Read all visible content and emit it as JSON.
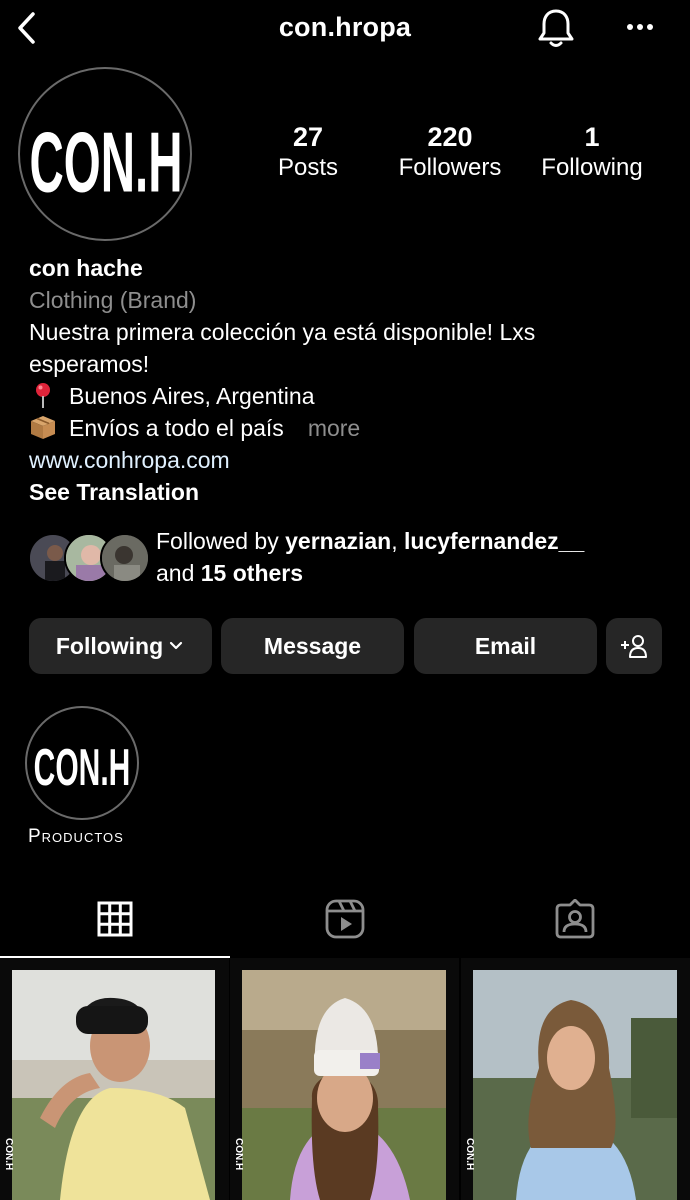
{
  "header": {
    "username": "con.hropa",
    "back_icon": "chevron-left-icon",
    "notification_icon": "bell-icon",
    "more_icon": "more-horizontal-icon"
  },
  "profile": {
    "avatar_text": "CON.H",
    "stats": [
      {
        "value": "27",
        "label": "Posts"
      },
      {
        "value": "220",
        "label": "Followers"
      },
      {
        "value": "1",
        "label": "Following"
      }
    ],
    "name": "con hache",
    "category": "Clothing (Brand)",
    "bio_line1": "Nuestra primera colección ya está disponible! Lxs",
    "bio_line2": "esperamos!",
    "location": "Buenos Aires, Argentina",
    "shipping": "Envíos a todo el país",
    "more_label": "more",
    "website": "www.conhropa.com",
    "see_translation": "See Translation"
  },
  "followed_by": {
    "prefix": "Followed by",
    "user1": "yernazian",
    "separator": ",",
    "user2": "lucyfernandez__",
    "and_label": "and",
    "others": "15 others"
  },
  "actions": {
    "following": "Following",
    "message": "Message",
    "email": "Email",
    "add_user_icon": "add-person-icon"
  },
  "highlight": {
    "label": "Productos",
    "cover_text": "CON.H"
  },
  "tabs": [
    {
      "name": "grid-icon",
      "active": true
    },
    {
      "name": "reels-icon",
      "active": false
    },
    {
      "name": "tagged-icon",
      "active": false
    }
  ],
  "posts": [
    {
      "film_label": "CON.H",
      "description": "man in black beanie and yellow shirt"
    },
    {
      "film_label": "CON.H",
      "description": "woman in white beanie"
    },
    {
      "film_label": "CON.H",
      "description": "woman in blue shirt"
    }
  ],
  "colors": {
    "background": "#000000",
    "button": "#262626",
    "secondary_text": "#8e8e8e",
    "link": "#e0f1ff"
  }
}
